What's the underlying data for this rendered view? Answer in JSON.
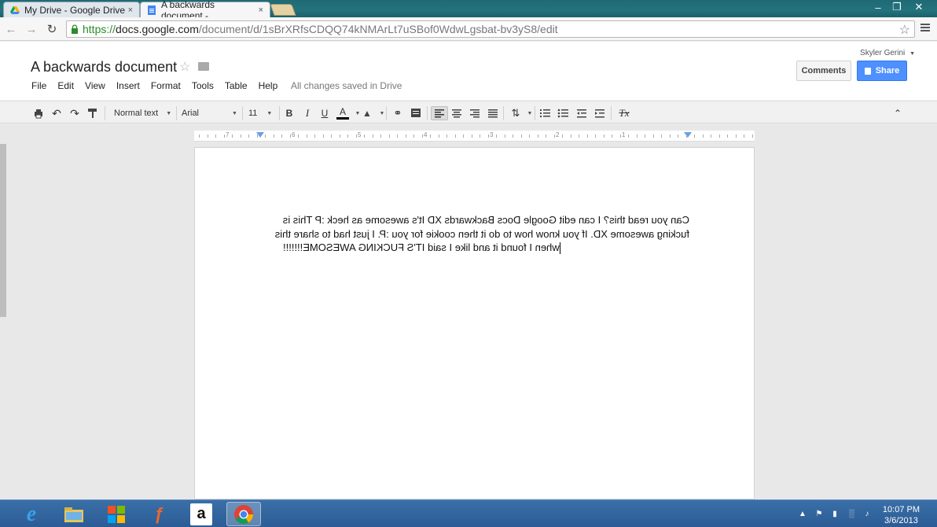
{
  "browser": {
    "tabs": [
      {
        "label": "My Drive - Google Drive",
        "close": "×"
      },
      {
        "label": "A backwards document -",
        "close": "×"
      }
    ],
    "url": {
      "scheme": "https://",
      "host": "docs.google.com",
      "path": "/document/d/1sBrXRfsCDQQ74kNMArLt7uSBof0WdwLgsbat-bv3yS8/edit"
    }
  },
  "doc": {
    "title": "A backwards document",
    "menu": [
      "File",
      "Edit",
      "View",
      "Insert",
      "Format",
      "Tools",
      "Table",
      "Help"
    ],
    "save_status": "All changes saved in Drive",
    "user": "Skyler Gerini",
    "comments_label": "Comments",
    "share_label": "Share",
    "toolbar": {
      "style": "Normal text",
      "font": "Arial",
      "size": "11",
      "bold": "B",
      "italic": "I",
      "underline": "U",
      "text_color": "A",
      "clear_format": "Tx"
    },
    "ruler_numbers": [
      "7",
      "6",
      "5",
      "4",
      "3",
      "2",
      "1"
    ],
    "body_lines": [
      "Can you read this? I can edit Google Docs Backwards XD It's awesome as heck :P This is",
      "fucking awesome XD. If you know how to do it then cookie for you :P. I just had to share this",
      "when I found it and like I said IT'S FUCKING AWESOME!!!!!!!"
    ]
  },
  "taskbar": {
    "time": "10:07 PM",
    "date": "3/6/2013",
    "apps": [
      "internet-explorer",
      "file-explorer",
      "media-center",
      "app-icon",
      "amazon",
      "chrome"
    ]
  }
}
